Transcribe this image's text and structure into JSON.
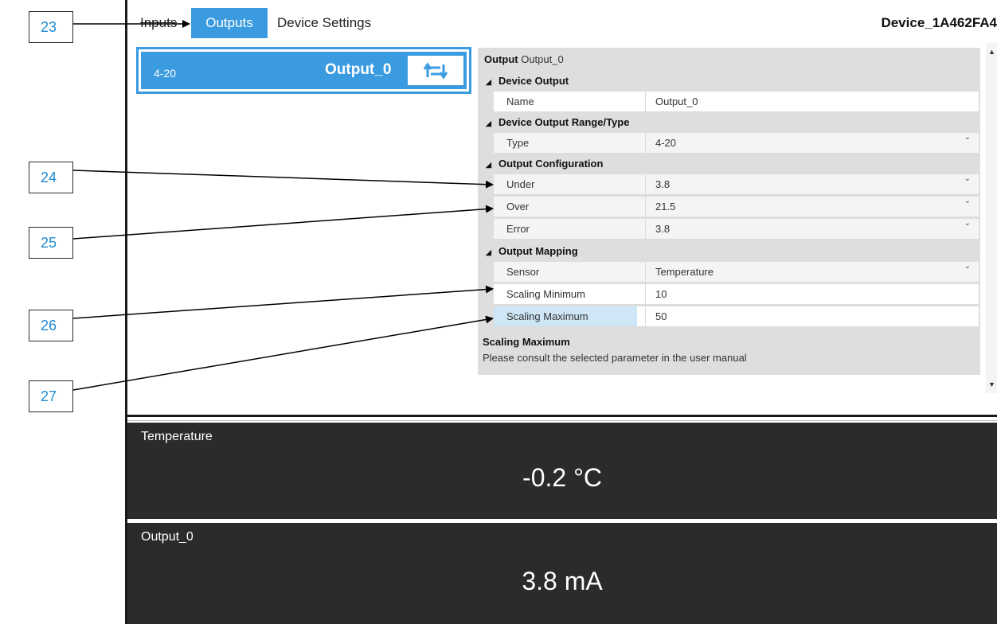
{
  "tabs": [
    {
      "label": "Inputs"
    },
    {
      "label": "Outputs"
    },
    {
      "label": "Device Settings"
    }
  ],
  "device_name": "Device_1A462FA4",
  "output_card": {
    "range": "4-20",
    "name": "Output_0",
    "action_icon": "repeat-icon"
  },
  "properties": {
    "title_prefix": "Output",
    "title_value": "Output_0",
    "categories": [
      {
        "label": "Device Output"
      },
      {
        "label": "Device Output Range/Type"
      },
      {
        "label": "Output Configuration"
      },
      {
        "label": "Output Mapping"
      }
    ],
    "rows": [
      {
        "label": "Name",
        "value": "Output_0"
      },
      {
        "label": "Type",
        "value": "4-20"
      },
      {
        "label": "Under",
        "value": "3.8"
      },
      {
        "label": "Over",
        "value": "21.5"
      },
      {
        "label": "Error",
        "value": "3.8"
      },
      {
        "label": "Sensor",
        "value": "Temperature"
      },
      {
        "label": "Scaling Minimum",
        "value": "10"
      },
      {
        "label": "Scaling Maximum",
        "value": "50"
      }
    ],
    "description_title": "Scaling Maximum",
    "description_text": "Please consult the selected parameter in the user manual"
  },
  "panels": {
    "temperature": {
      "label": "Temperature",
      "value": "-0.2 °C"
    },
    "output": {
      "label": "Output_0",
      "value": "3.8 mA"
    }
  },
  "callouts": [
    "23",
    "24",
    "25",
    "26",
    "27"
  ],
  "colors": {
    "accent": "#3b9be0",
    "panel_bg": "#2b2b2b",
    "callout_text": "#1f8bd0"
  }
}
